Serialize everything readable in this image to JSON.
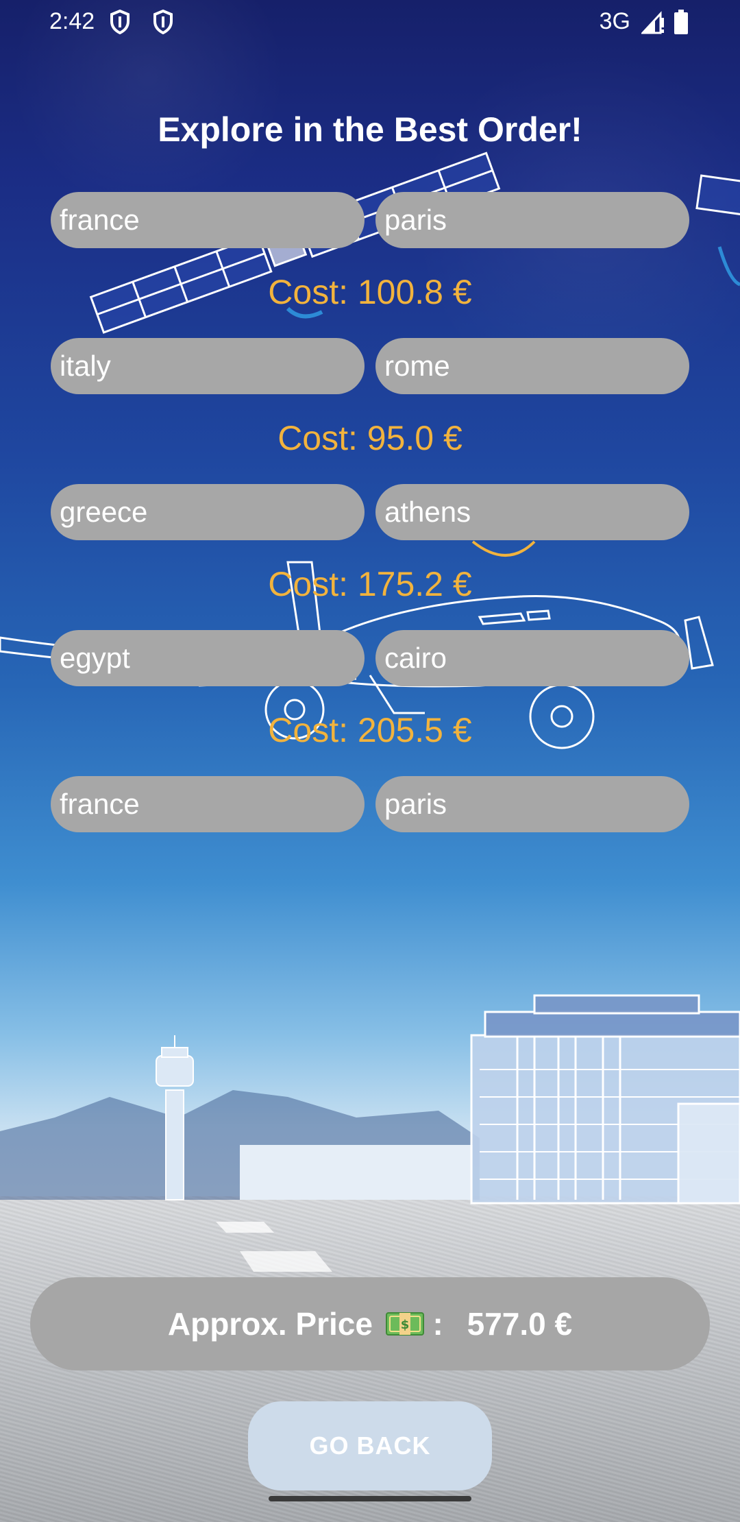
{
  "status_bar": {
    "time": "2:42",
    "network": "3G",
    "icons": [
      "shield-icon",
      "shield-icon",
      "signal-icon",
      "battery-icon"
    ]
  },
  "title": "Explore in the Best Order!",
  "stops": [
    {
      "country": "france",
      "city": "paris"
    },
    {
      "country": "italy",
      "city": "rome"
    },
    {
      "country": "greece",
      "city": "athens"
    },
    {
      "country": "egypt",
      "city": "cairo"
    },
    {
      "country": "france",
      "city": "paris"
    }
  ],
  "costs": [
    "Cost: 100.8 €",
    "Cost: 95.0 €",
    "Cost: 175.2 €",
    "Cost: 205.5 €"
  ],
  "approx": {
    "label": "Approx. Price",
    "icon": "money-icon",
    "colon": ":",
    "value": "577.0 €"
  },
  "go_back_label": "GO BACK",
  "colors": {
    "pill": "#a7a7a7",
    "cost": "#f2b33d",
    "go_back": "#cddbea",
    "sky_top": "#16206a"
  }
}
